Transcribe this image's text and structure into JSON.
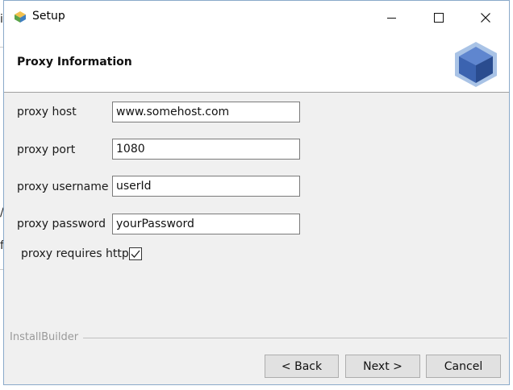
{
  "window": {
    "title": "Setup"
  },
  "header": {
    "title": "Proxy Information"
  },
  "form": {
    "fields": [
      {
        "label": "proxy host",
        "value": "www.somehost.com"
      },
      {
        "label": "proxy port",
        "value": "1080"
      },
      {
        "label": "proxy username",
        "value": "userId"
      },
      {
        "label": "proxy password",
        "value": "yourPassword"
      }
    ],
    "https": {
      "label": "proxy requires https",
      "checked": true
    }
  },
  "footer": {
    "brand": "InstallBuilder",
    "back_label": "< Back",
    "next_label": "Next >",
    "cancel_label": "Cancel"
  },
  "background": {
    "fragments": [
      "i",
      "/",
      "f"
    ]
  },
  "colors": {
    "accent_border": "#8aa9c9",
    "button_bg": "#e1e1e1",
    "logo_blue": "#3b63b0",
    "logo_halo": "#a9c3e6"
  },
  "icons": {
    "app": "setup-app-icon",
    "minimize": "minimize-icon",
    "maximize": "maximize-icon",
    "close": "close-icon",
    "logo": "installbuilder-cube-logo",
    "checkbox": "checkmark-icon"
  }
}
